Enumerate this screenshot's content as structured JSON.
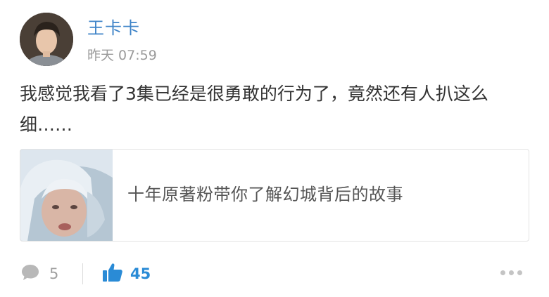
{
  "post": {
    "username": "王卡卡",
    "timestamp": "昨天 07:59",
    "text": "我感觉我看了3集已经是很勇敢的行为了，竟然还有人扒这么细……"
  },
  "link_card": {
    "title": "十年原著粉带你了解幻城背后的故事"
  },
  "actions": {
    "comment_count": "5",
    "like_count": "45",
    "comment_icon": "comment-bubble-icon",
    "like_icon": "thumbs-up-icon",
    "more_icon": "more-dots-icon"
  },
  "colors": {
    "username": "#3f84c8",
    "like_accent": "#2a8bd6",
    "muted": "#9a9a9a"
  }
}
